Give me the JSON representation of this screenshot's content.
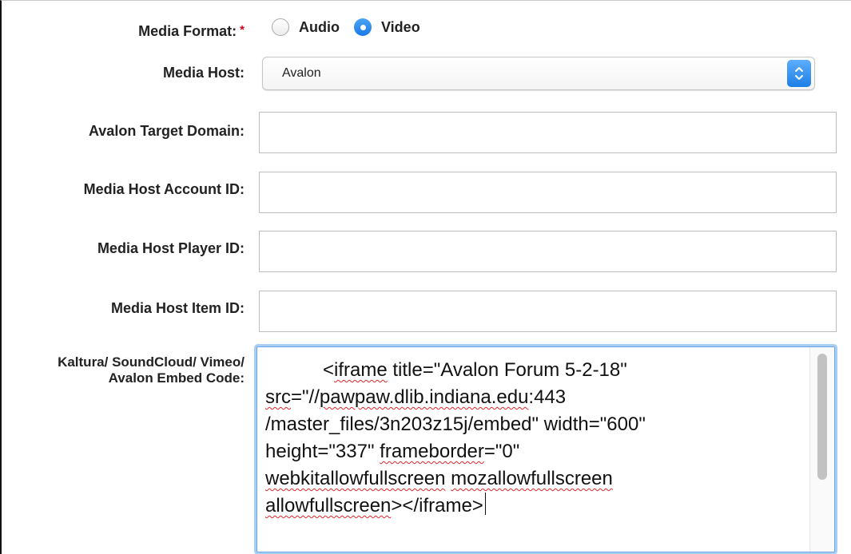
{
  "form": {
    "media_format": {
      "label": "Media Format:",
      "required_mark": "*",
      "options": [
        {
          "label": "Audio",
          "checked": false
        },
        {
          "label": "Video",
          "checked": true
        }
      ]
    },
    "media_host": {
      "label": "Media Host:",
      "value": "Avalon"
    },
    "target_domain": {
      "label": "Avalon Target Domain:",
      "value": ""
    },
    "account_id": {
      "label": "Media Host Account ID:",
      "value": ""
    },
    "player_id": {
      "label": "Media Host Player ID:",
      "value": ""
    },
    "item_id": {
      "label": "Media Host Item ID:",
      "value": ""
    },
    "embed_code": {
      "label": "Kaltura/ SoundCloud/ Vimeo/ Avalon Embed Code:",
      "lines": [
        {
          "indent": "\t",
          "pre": "<",
          "spell": "iframe",
          "post": " title=\"Avalon Forum 5-2-18\""
        },
        {
          "pre": "",
          "spell": "src",
          "mid": "=\"//",
          "spell2": "pawpaw.dlib.indiana.edu",
          "post": ":443"
        },
        {
          "pre": "/master_files/3n203z15j/embed\" width=\"600\""
        },
        {
          "pre": "height=\"337\" ",
          "spell": "frameborder",
          "post": "=\"0\""
        },
        {
          "pre": "",
          "spell": "webkitallowfullscreen",
          "mid": " ",
          "spell2": "mozallowfullscreen",
          "post": ""
        },
        {
          "pre": "",
          "spell": "allowfullscreen",
          "post": "></iframe>"
        }
      ]
    }
  },
  "colors": {
    "accent": "#1a7be8",
    "required": "#d0021b",
    "focus_ring": "#a8cdf3",
    "spell_underline": "#e0262b"
  },
  "icons": {
    "select_arrow": "chevron-up-down-icon"
  }
}
